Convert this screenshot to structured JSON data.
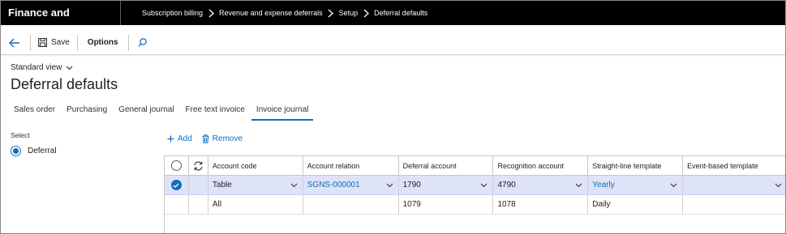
{
  "app": {
    "title": "Finance and Operations"
  },
  "breadcrumbs": [
    "Subscription billing",
    "Revenue and expense deferrals",
    "Setup",
    "Deferral defaults"
  ],
  "actionbar": {
    "save_label": "Save",
    "options_label": "Options"
  },
  "page": {
    "view_label": "Standard view",
    "title": "Deferral defaults"
  },
  "tabs": [
    {
      "label": "Sales order",
      "active": false
    },
    {
      "label": "Purchasing",
      "active": false
    },
    {
      "label": "General journal",
      "active": false
    },
    {
      "label": "Free text invoice",
      "active": false
    },
    {
      "label": "Invoice journal",
      "active": true
    }
  ],
  "select": {
    "label": "Select",
    "option": "Deferral"
  },
  "grid_toolbar": {
    "add_label": "Add",
    "remove_label": "Remove"
  },
  "grid": {
    "columns": [
      "Account code",
      "Account relation",
      "Deferral account",
      "Recognition account",
      "Straight-line template",
      "Event-based template"
    ],
    "rows": [
      {
        "selected": true,
        "account_code": "Table",
        "account_relation": "SGNS-000001",
        "deferral_account": "1790",
        "recognition_account": "4790",
        "straight_line_template": "Yearly",
        "event_based_template": ""
      },
      {
        "selected": false,
        "account_code": "All",
        "account_relation": "",
        "deferral_account": "1079",
        "recognition_account": "1078",
        "straight_line_template": "Daily",
        "event_based_template": ""
      }
    ]
  },
  "colors": {
    "accent": "#0f6cbd",
    "topbar": "#000000",
    "selected_row": "#dfe3f7"
  }
}
